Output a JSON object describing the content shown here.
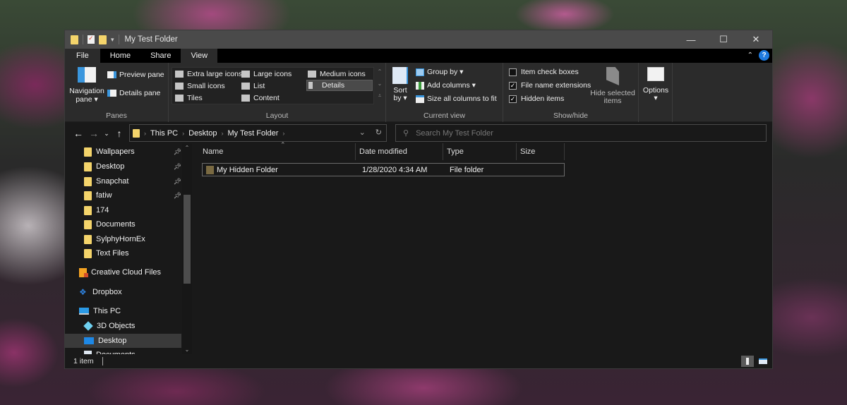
{
  "window": {
    "title": "My Test Folder",
    "controls": {
      "minimize": "—",
      "maximize": "☐",
      "close": "✕"
    }
  },
  "ribbon_tabs": [
    {
      "label": "File"
    },
    {
      "label": "Home"
    },
    {
      "label": "Share"
    },
    {
      "label": "View",
      "active": true
    }
  ],
  "ribbon": {
    "panes": {
      "label": "Panes",
      "navigation_pane": "Navigation pane",
      "navigation_pane_line1": "Navigation",
      "navigation_pane_line2": "pane ▾",
      "preview_pane": "Preview pane",
      "details_pane": "Details pane"
    },
    "layout": {
      "label": "Layout",
      "items": [
        "Extra large icons",
        "Large icons",
        "Medium icons",
        "Small icons",
        "List",
        "Details",
        "Tiles",
        "Content"
      ],
      "selected": "Details"
    },
    "current_view": {
      "label": "Current view",
      "sort_by_line1": "Sort",
      "sort_by_line2": "by ▾",
      "group_by": "Group by ▾",
      "add_columns": "Add columns ▾",
      "size_all_columns": "Size all columns to fit"
    },
    "show_hide": {
      "label": "Show/hide",
      "item_check_boxes": {
        "label": "Item check boxes",
        "checked": false
      },
      "file_name_extensions": {
        "label": "File name extensions",
        "checked": true
      },
      "hidden_items": {
        "label": "Hidden items",
        "checked": true
      },
      "hide_selected_line1": "Hide selected",
      "hide_selected_line2": "items"
    },
    "options": {
      "label": "Options",
      "caret": "▾"
    }
  },
  "navigation": {
    "back": "←",
    "forward": "→",
    "recent": "⌄",
    "up": "↑",
    "breadcrumb": [
      "This PC",
      "Desktop",
      "My Test Folder"
    ],
    "search_placeholder": "Search My Test Folder"
  },
  "sidebar": {
    "items": [
      {
        "label": "Wallpapers",
        "icon": "folder",
        "pinned": true
      },
      {
        "label": "Desktop",
        "icon": "folder",
        "pinned": true
      },
      {
        "label": "Snapchat",
        "icon": "folder",
        "pinned": true
      },
      {
        "label": "fatiw",
        "icon": "folder",
        "pinned": true
      },
      {
        "label": "174",
        "icon": "folder",
        "pinned": false
      },
      {
        "label": "Documents",
        "icon": "folder",
        "pinned": false
      },
      {
        "label": "SylphyHornEx",
        "icon": "folder",
        "pinned": false
      },
      {
        "label": "Text Files",
        "icon": "folder",
        "pinned": false
      },
      {
        "label": "Creative Cloud Files",
        "icon": "creative-cloud"
      },
      {
        "label": "Dropbox",
        "icon": "dropbox"
      },
      {
        "label": "This PC",
        "icon": "this-pc"
      },
      {
        "label": "3D Objects",
        "icon": "3d-objects"
      },
      {
        "label": "Desktop",
        "icon": "desktop",
        "selected": true
      },
      {
        "label": "Documents",
        "icon": "documents"
      }
    ]
  },
  "file_list": {
    "columns": [
      "Name",
      "Date modified",
      "Type",
      "Size"
    ],
    "rows": [
      {
        "name": "My Hidden Folder",
        "date_modified": "1/28/2020 4:34 AM",
        "type": "File folder",
        "size": ""
      }
    ]
  },
  "status": {
    "item_count": "1 item"
  }
}
